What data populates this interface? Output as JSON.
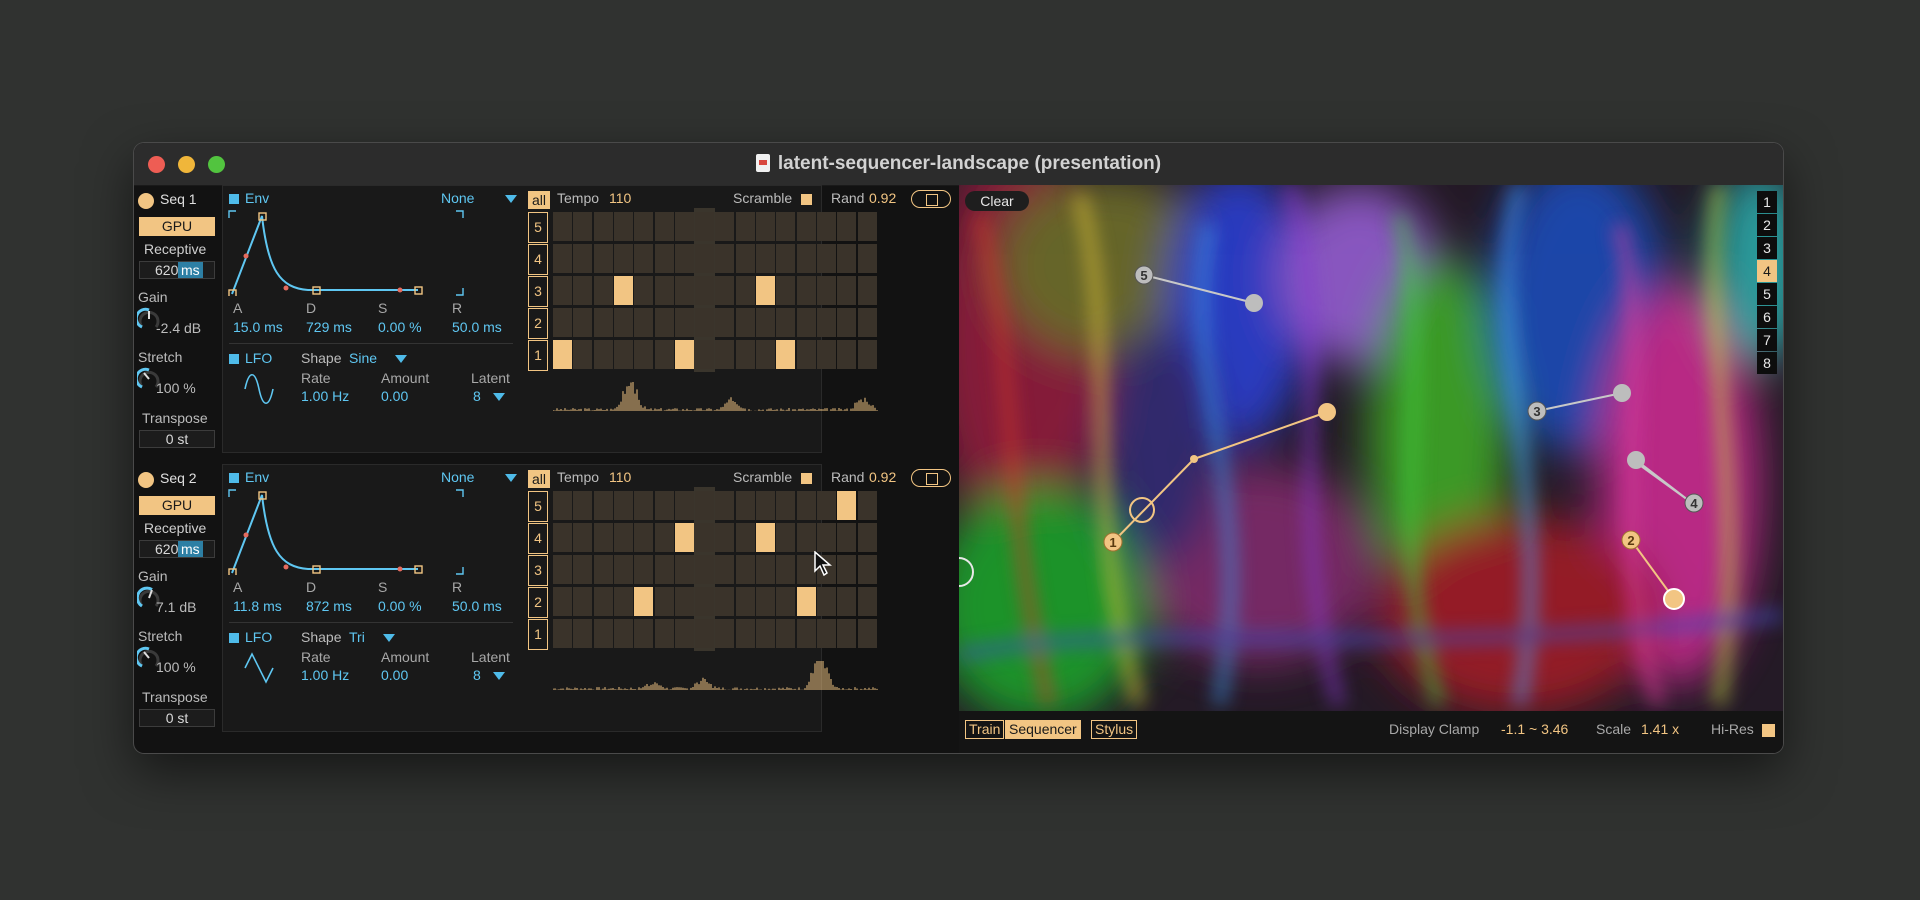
{
  "window": {
    "title": "latent-sequencer-landscape (presentation)"
  },
  "seq1": {
    "name": "Seq 1",
    "gpu": "GPU",
    "receptive_label": "Receptive",
    "receptive_value": "620",
    "receptive_unit": "ms",
    "gain_label": "Gain",
    "gain_value": "-2.4 dB",
    "stretch_label": "Stretch",
    "stretch_value": "100 %",
    "transpose_label": "Transpose",
    "transpose_value": "0 st",
    "env": {
      "label": "Env",
      "mode": "None",
      "a_label": "A",
      "d_label": "D",
      "s_label": "S",
      "r_label": "R",
      "a": "15.0 ms",
      "d": "729 ms",
      "s": "0.00 %",
      "r": "50.0 ms"
    },
    "lfo": {
      "label": "LFO",
      "shape_label": "Shape",
      "shape": "Sine",
      "rate_label": "Rate",
      "rate": "1.00 Hz",
      "amount_label": "Amount",
      "amount": "0.00",
      "latent_label": "Latent",
      "latent": "8"
    },
    "seq": {
      "all": "all",
      "tempo_label": "Tempo",
      "tempo": "110",
      "scramble_label": "Scramble",
      "rand_label": "Rand",
      "rand": "0.92",
      "rows": [
        "5",
        "4",
        "3",
        "2",
        "1"
      ],
      "active_cells": [
        [
          3,
          3
        ],
        [
          3,
          10
        ],
        [
          5,
          0
        ],
        [
          5,
          6
        ],
        [
          5,
          11
        ]
      ],
      "highlight_col": 7
    }
  },
  "seq2": {
    "name": "Seq 2",
    "gpu": "GPU",
    "receptive_label": "Receptive",
    "receptive_value": "620",
    "receptive_unit": "ms",
    "gain_label": "Gain",
    "gain_value": "7.1 dB",
    "stretch_label": "Stretch",
    "stretch_value": "100 %",
    "transpose_label": "Transpose",
    "transpose_value": "0 st",
    "env": {
      "label": "Env",
      "mode": "None",
      "a_label": "A",
      "d_label": "D",
      "s_label": "S",
      "r_label": "R",
      "a": "11.8 ms",
      "d": "872 ms",
      "s": "0.00 %",
      "r": "50.0 ms"
    },
    "lfo": {
      "label": "LFO",
      "shape_label": "Shape",
      "shape": "Tri",
      "rate_label": "Rate",
      "rate": "1.00 Hz",
      "amount_label": "Amount",
      "amount": "0.00",
      "latent_label": "Latent",
      "latent": "8"
    },
    "seq": {
      "all": "all",
      "tempo_label": "Tempo",
      "tempo": "110",
      "scramble_label": "Scramble",
      "rand_label": "Rand",
      "rand": "0.92",
      "rows": [
        "5",
        "4",
        "3",
        "2",
        "1"
      ],
      "active_cells": [
        [
          1,
          14
        ],
        [
          2,
          6
        ],
        [
          2,
          10
        ],
        [
          4,
          4
        ],
        [
          4,
          12
        ]
      ],
      "highlight_col": 7
    }
  },
  "canvas": {
    "clear": "Clear",
    "layers": [
      "1",
      "2",
      "3",
      "4",
      "5",
      "6",
      "7",
      "8"
    ],
    "selected_layer": "4",
    "points": [
      "1",
      "2",
      "3",
      "4",
      "5"
    ]
  },
  "bottom": {
    "tabs": [
      "Train",
      "Sequencer",
      "Stylus"
    ],
    "selected_tab": "Sequencer",
    "display_clamp_label": "Display Clamp",
    "display_clamp_value": "-1.1 ~ 3.46",
    "scale_label": "Scale",
    "scale_value": "1.41 x",
    "hires_label": "Hi-Res"
  },
  "colors": {
    "accent": "#f2c583",
    "blue": "#5fc7f2",
    "window_bg": "#121212"
  }
}
